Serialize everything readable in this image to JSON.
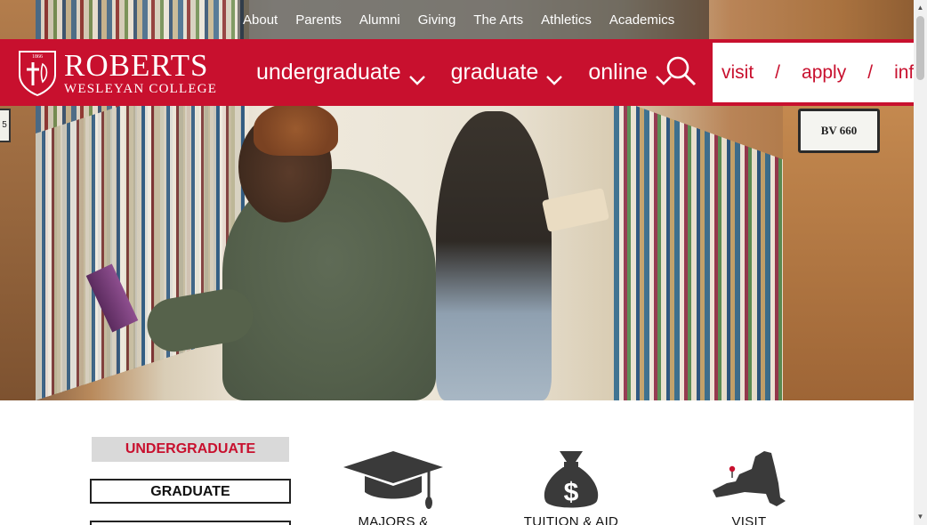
{
  "utility_nav": {
    "items": [
      "About",
      "Parents",
      "Alumni",
      "Giving",
      "The Arts",
      "Athletics",
      "Academics"
    ]
  },
  "logo": {
    "year": "1866",
    "name": "ROBERTS",
    "subtitle": "WESLEYAN COLLEGE"
  },
  "main_nav": {
    "items": [
      {
        "label": "undergraduate",
        "icon": "chevron-down-icon"
      },
      {
        "label": "graduate",
        "icon": "chevron-down-icon"
      },
      {
        "label": "online",
        "icon": "chevron-down-icon"
      }
    ],
    "search_icon": "search-icon"
  },
  "cta": {
    "visit": "visit",
    "sep": "/",
    "apply": "apply",
    "info": "info"
  },
  "hero": {
    "shelf_label": "BV 660",
    "shelf_label_left": "5"
  },
  "program_tabs": {
    "undergraduate": "UNDERGRADUATE",
    "graduate": "GRADUATE",
    "online": ""
  },
  "features": [
    {
      "label": "MAJORS &",
      "icon": "graduation-cap-icon"
    },
    {
      "label": "TUITION & AID",
      "icon": "money-bag-icon"
    },
    {
      "label": "VISIT",
      "icon": "new-york-state-map-icon"
    }
  ],
  "colors": {
    "brand_red": "#c8102e",
    "tab_active_bg": "#d9d9d9",
    "icon_gray": "#3a3a3a"
  }
}
